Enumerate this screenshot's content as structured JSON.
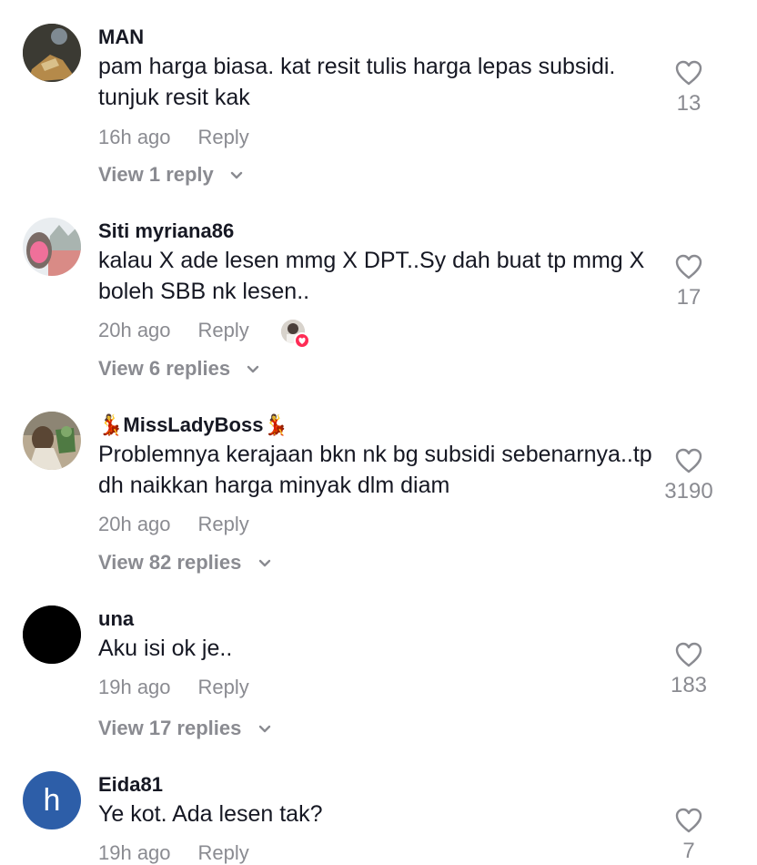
{
  "colors": {
    "text": "#161823",
    "muted": "#8a8b91",
    "accent": "#fe2c55",
    "avatar_blue": "#2d5ea8"
  },
  "comments": [
    {
      "username": "MAN",
      "text": "pam harga biasa. kat resit tulis harga lepas subsidi. tunjuk resit kak",
      "time": "16h ago",
      "reply_label": "Reply",
      "view_replies": "View 1 reply",
      "likes": "13",
      "avatar_icon": "photo-avatar-icon"
    },
    {
      "username": "Siti myriana86",
      "text": "kalau X ade lesen mmg X DPT..Sy dah buat tp mmg X boleh SBB nk lesen..",
      "time": "20h ago",
      "reply_label": "Reply",
      "view_replies": "View 6 replies",
      "likes": "17",
      "avatar_icon": "photo-avatar-icon"
    },
    {
      "username": "💃MissLadyBoss💃",
      "text": "Problemnya kerajaan bkn nk bg subsidi sebenarnya..tp dh naikkan harga minyak dlm diam",
      "time": "20h ago",
      "reply_label": "Reply",
      "view_replies": "View 82 replies",
      "likes": "3190",
      "avatar_icon": "photo-avatar-icon"
    },
    {
      "username": "una",
      "text": "Aku isi ok je..",
      "time": "19h ago",
      "reply_label": "Reply",
      "view_replies": "View 17 replies",
      "likes": "183",
      "avatar_icon": "black-avatar-icon"
    },
    {
      "username": "Eida81",
      "text": "Ye kot. Ada lesen tak?",
      "time": "19h ago",
      "reply_label": "Reply",
      "likes": "7",
      "avatar_letter": "h",
      "avatar_icon": "letter-avatar-icon"
    }
  ]
}
